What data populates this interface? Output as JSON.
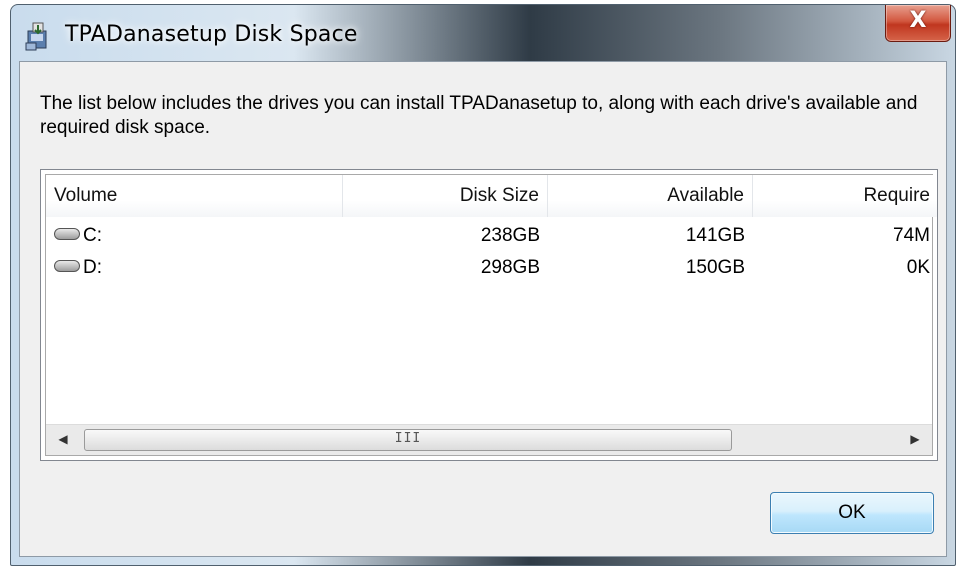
{
  "window": {
    "title": "TPADanasetup Disk Space",
    "close_label": "X"
  },
  "description": "The list below includes the drives you can install TPADanasetup to, along with each drive's available and required disk space.",
  "table": {
    "columns": [
      "Volume",
      "Disk Size",
      "Available",
      "Require"
    ],
    "rows": [
      {
        "volume": "C:",
        "disk_size": "238GB",
        "available": "141GB",
        "required": "74M"
      },
      {
        "volume": "D:",
        "disk_size": "298GB",
        "available": "150GB",
        "required": "0K"
      }
    ]
  },
  "scrollbar": {
    "grip": "III",
    "left_arrow": "◀",
    "right_arrow": "▶"
  },
  "buttons": {
    "ok_label": "OK"
  },
  "icons": {
    "app": "installer-icon",
    "drive": "hard-drive-icon",
    "close": "close-icon"
  },
  "colors": {
    "close_button": "#c0361f",
    "dialog_background": "#f0f0f0",
    "ok_button_border": "#3c7fb1"
  }
}
